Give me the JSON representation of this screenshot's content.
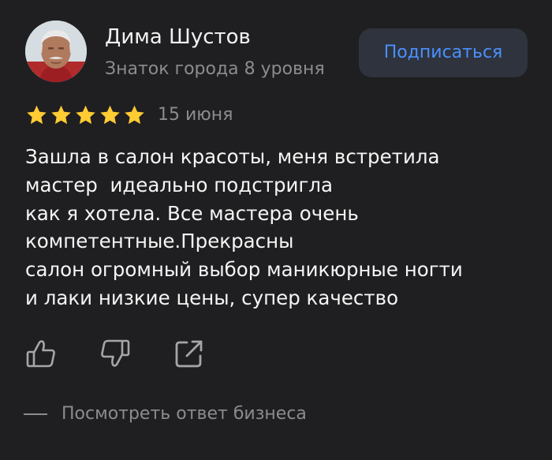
{
  "author": {
    "name": "Дима Шустов",
    "level": "Знаток города 8 уровня"
  },
  "subscribe_label": "Подписаться",
  "review": {
    "rating": 5,
    "max_rating": 5,
    "date": "15 июня",
    "lines": [
      "Зашла в салон красоты, меня встретила",
      "мастер  идеально подстригла",
      "как я хотела. Все мастера очень",
      "компетентные.Прекрасны",
      "салон огромный выбор маникюрные ногти",
      "и лаки низкие цены, супер качество"
    ]
  },
  "actions": [
    {
      "icon": "thumbs-up-icon"
    },
    {
      "icon": "thumbs-down-icon"
    },
    {
      "icon": "share-icon"
    }
  ],
  "business_reply_label": "Посмотреть ответ бизнеса",
  "colors": {
    "background": "#1f1f21",
    "star": "#ffcc33",
    "accent": "#4b90ff",
    "button_bg": "#2e333d",
    "muted": "#8c8c8f"
  }
}
